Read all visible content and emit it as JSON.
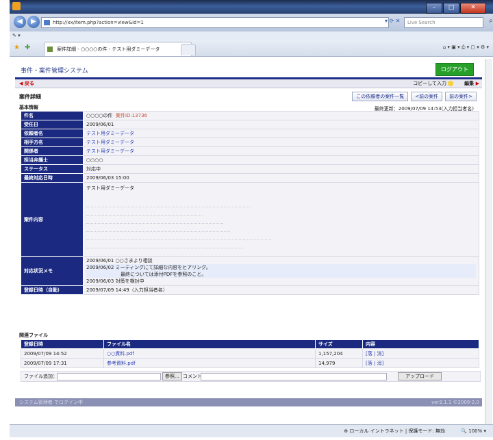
{
  "browser": {
    "title": "",
    "address": "http://xx/item.php?action=view&id=1",
    "search_placeholder": "Live Search",
    "tab_title": "案件詳細 - ○○○○の件 - テスト用ダミーデータ",
    "menu_text": "",
    "zoom": "100%",
    "zone": "ローカル イントラネット | 保護モード: 無効"
  },
  "app": {
    "title": "事件・案件管理システム",
    "logout": "ログアウト",
    "back": "戻る",
    "copy_input": "コピーして入力",
    "edit": "編集",
    "page_title": "案件詳細",
    "btn_list": "この依頼者の案件一覧",
    "btn_prev": "<前の案件",
    "btn_next": "前の案件>",
    "section_basic": "基本情報",
    "updated": "最終更新：2009/07/09 14:53(入力担当者名)",
    "section_files": "関連ファイル",
    "footer_left": "システム管理者 でログイン中",
    "footer_right": "ver2.1.1 ©2009-2.0"
  },
  "details": [
    {
      "label": "件名",
      "value": "○○○○の件",
      "extra": "案件ID:13736"
    },
    {
      "label": "受任日",
      "value": "2009/06/01"
    },
    {
      "label": "依頼者名",
      "value": "テスト用ダミーデータ"
    },
    {
      "label": "相手方名",
      "value": "テスト用ダミーデータ"
    },
    {
      "label": "関係者",
      "value": "テスト用ダミーデータ"
    },
    {
      "label": "担当弁護士",
      "value": "○○○○"
    },
    {
      "label": "ステータス",
      "value": "対応中"
    },
    {
      "label": "最終対応日時",
      "value": "2009/06/03 15:00"
    }
  ],
  "content_row": {
    "label": "案件内容",
    "first_line": "テスト用ダミーデータ"
  },
  "memo": {
    "label": "対応状況メモ",
    "lines": [
      "2009/06/01 ○○さまより相談",
      "2009/06/02 ミーティングにて詳細な内容をヒアリング。",
      "最終については添付PDFを参照のこと。",
      "2009/06/03 対策を検討中"
    ]
  },
  "registered": {
    "label": "登録日時（自動）",
    "value": "2009/07/09 14:49（入力担当者名）"
  },
  "file_headers": [
    "登録日時",
    "ファイル名",
    "サイズ",
    "内容"
  ],
  "files": [
    {
      "date": "2009/07/09 14:52",
      "name": "○○資料.pdf",
      "size": "1,157,204",
      "ops": "[落 | 消]"
    },
    {
      "date": "2009/07/09 17:31",
      "name": "参考資料.pdf",
      "size": "14,979",
      "ops": "[落 | 消]"
    }
  ],
  "file_add": {
    "label": "ファイル追加：",
    "browse": "参照...",
    "comment": "コメント：",
    "upload": "アップロード"
  }
}
